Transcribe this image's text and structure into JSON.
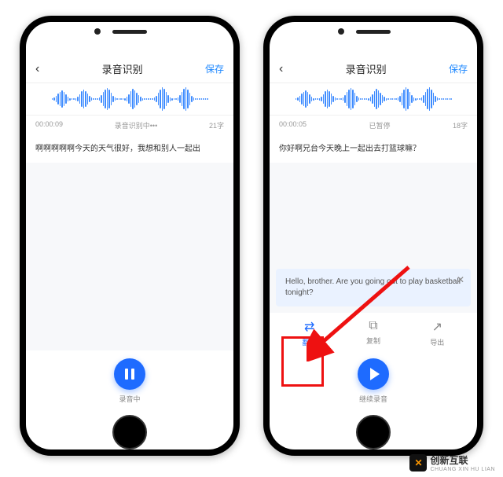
{
  "nav": {
    "title": "录音识别",
    "save": "保存"
  },
  "left": {
    "time": "00:00:09",
    "status": "录音识别中•••",
    "count": "21字",
    "transcript": "啊啊啊啊啊今天的天气很好，我想和别人一起出",
    "rec_label": "录音中"
  },
  "right": {
    "time": "00:00:05",
    "status": "已暂停",
    "count": "18字",
    "transcript": "你好啊兄台今天晚上一起出去打篮球嘛？",
    "translation": "Hello, brother. Are you going out to play basketball tonight?",
    "actions": {
      "translate": "翻译",
      "copy": "复制",
      "export": "导出"
    },
    "rec_label": "继续录音"
  },
  "watermark": {
    "brand": "创新互联",
    "sub": "CHUANG XIN HU LIAN"
  }
}
